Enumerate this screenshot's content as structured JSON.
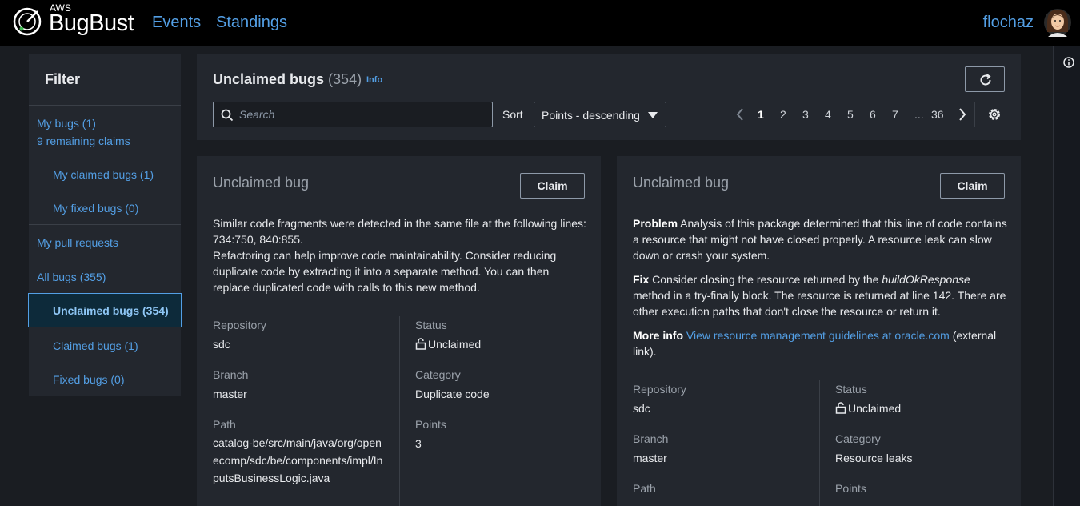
{
  "app": {
    "logo_small": "AWS",
    "logo_name": "BugBust",
    "nav": [
      "Events",
      "Standings"
    ],
    "username": "flochaz"
  },
  "filter": {
    "title": "Filter",
    "my_bugs": "My bugs (1)",
    "remaining_claims": "9 remaining claims",
    "my_claimed": "My claimed bugs (1)",
    "my_fixed": "My fixed bugs (0)",
    "pull_requests": "My pull requests",
    "all_bugs": "All bugs (355)",
    "unclaimed": "Unclaimed bugs (354)",
    "claimed": "Claimed bugs (1)",
    "fixed": "Fixed bugs (0)"
  },
  "header": {
    "title": "Unclaimed bugs",
    "count": "(354)",
    "info": "Info",
    "search_placeholder": "Search",
    "sort_label": "Sort",
    "sort_value": "Points - descending",
    "pages": [
      "1",
      "2",
      "3",
      "4",
      "5",
      "6",
      "7",
      "...",
      "36"
    ],
    "current_page": "1"
  },
  "cards": [
    {
      "title": "Unclaimed bug",
      "claim": "Claim",
      "desc_line1": "Similar code fragments were detected in the same file at the following lines: 734:750, 840:855.",
      "desc_line2": "Refactoring can help improve code maintainability. Consider reducing duplicate code by extracting it into a separate method. You can then replace duplicated code with calls to this new method.",
      "repository_label": "Repository",
      "repository": "sdc",
      "branch_label": "Branch",
      "branch": "master",
      "path_label": "Path",
      "path": "catalog-be/src/main/java/org/openecomp/sdc/be/components/impl/InputsBusinessLogic.java",
      "status_label": "Status",
      "status": "Unclaimed",
      "category_label": "Category",
      "category": "Duplicate code",
      "points_label": "Points",
      "points": "3"
    },
    {
      "title": "Unclaimed bug",
      "claim": "Claim",
      "problem_label": "Problem",
      "problem": "Analysis of this package determined that this line of code contains a resource that might not have closed properly. A resource leak can slow down or crash your system.",
      "fix_label": "Fix",
      "fix_pre": "Consider closing the resource returned by the",
      "fix_method": "buildOkResponse",
      "fix_post": "method in a try-finally block. The resource is returned at line 142. There are other execution paths that don't close the resource or return it.",
      "more_label": "More info",
      "more_link": "View resource management guidelines at oracle.com",
      "more_post": "(external link).",
      "repository_label": "Repository",
      "repository": "sdc",
      "branch_label": "Branch",
      "branch": "master",
      "path_label": "Path",
      "status_label": "Status",
      "status": "Unclaimed",
      "category_label": "Category",
      "category": "Resource leaks",
      "points_label": "Points"
    }
  ]
}
